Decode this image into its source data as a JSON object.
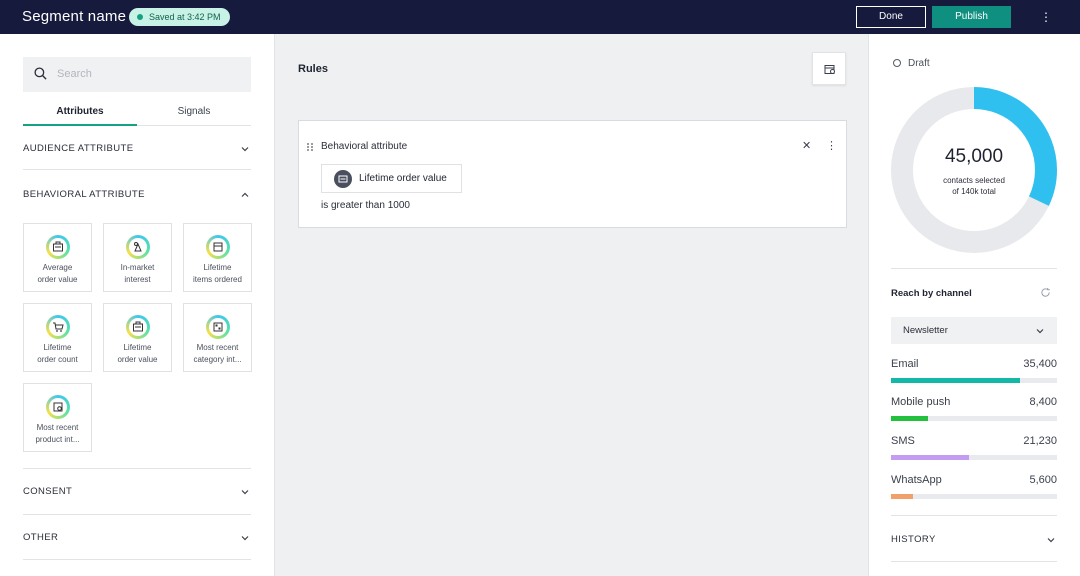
{
  "topbar": {
    "title": "Segment name",
    "saved": "Saved at 3:42 PM",
    "done_label": "Done",
    "publish_label": "Publish",
    "more_icon": "kebab-icon"
  },
  "left": {
    "search_placeholder": "Search",
    "tabs": [
      "Attributes",
      "Signals"
    ],
    "active_tab": "Attributes",
    "sections": {
      "audience": "AUDIENCE ATTRIBUTE",
      "behavioral": "BEHAVIORAL ATTRIBUTE",
      "consent": "CONSENT",
      "other": "OTHER"
    },
    "tiles": [
      {
        "label": "Average\norder value",
        "icon": "receipt-icon"
      },
      {
        "label": "In-market\ninterest",
        "icon": "shapes-icon"
      },
      {
        "label": "Lifetime\nitems ordered",
        "icon": "box-icon"
      },
      {
        "label": "Lifetime\norder count",
        "icon": "cart-icon"
      },
      {
        "label": "Lifetime\norder value",
        "icon": "receipt-icon"
      },
      {
        "label": "Most recent\ncategory int...",
        "icon": "grid-icon"
      },
      {
        "label": "Most recent\nproduct int...",
        "icon": "product-icon"
      }
    ]
  },
  "middle": {
    "title": "Rules",
    "rule": {
      "heading": "Behavioral attribute",
      "attribute": "Lifetime order value",
      "condition": "is greater than 1000"
    }
  },
  "right": {
    "status": "Draft",
    "contacts_value": "45,000",
    "contacts_sub_1": "contacts selected",
    "contacts_sub_2": "of 140k total",
    "selected_fraction": 0.321,
    "reach_title": "Reach by channel",
    "channel_select": "Newsletter",
    "channels": [
      {
        "name": "Email",
        "value": "35,400",
        "fraction": 0.78,
        "color": "#14b8a6"
      },
      {
        "name": "Mobile push",
        "value": "8,400",
        "fraction": 0.22,
        "color": "#22c03c"
      },
      {
        "name": "SMS",
        "value": "21,230",
        "fraction": 0.47,
        "color": "#c39bf0"
      },
      {
        "name": "WhatsApp",
        "value": "5,600",
        "fraction": 0.13,
        "color": "#f2a06b"
      }
    ],
    "history": "HISTORY"
  }
}
